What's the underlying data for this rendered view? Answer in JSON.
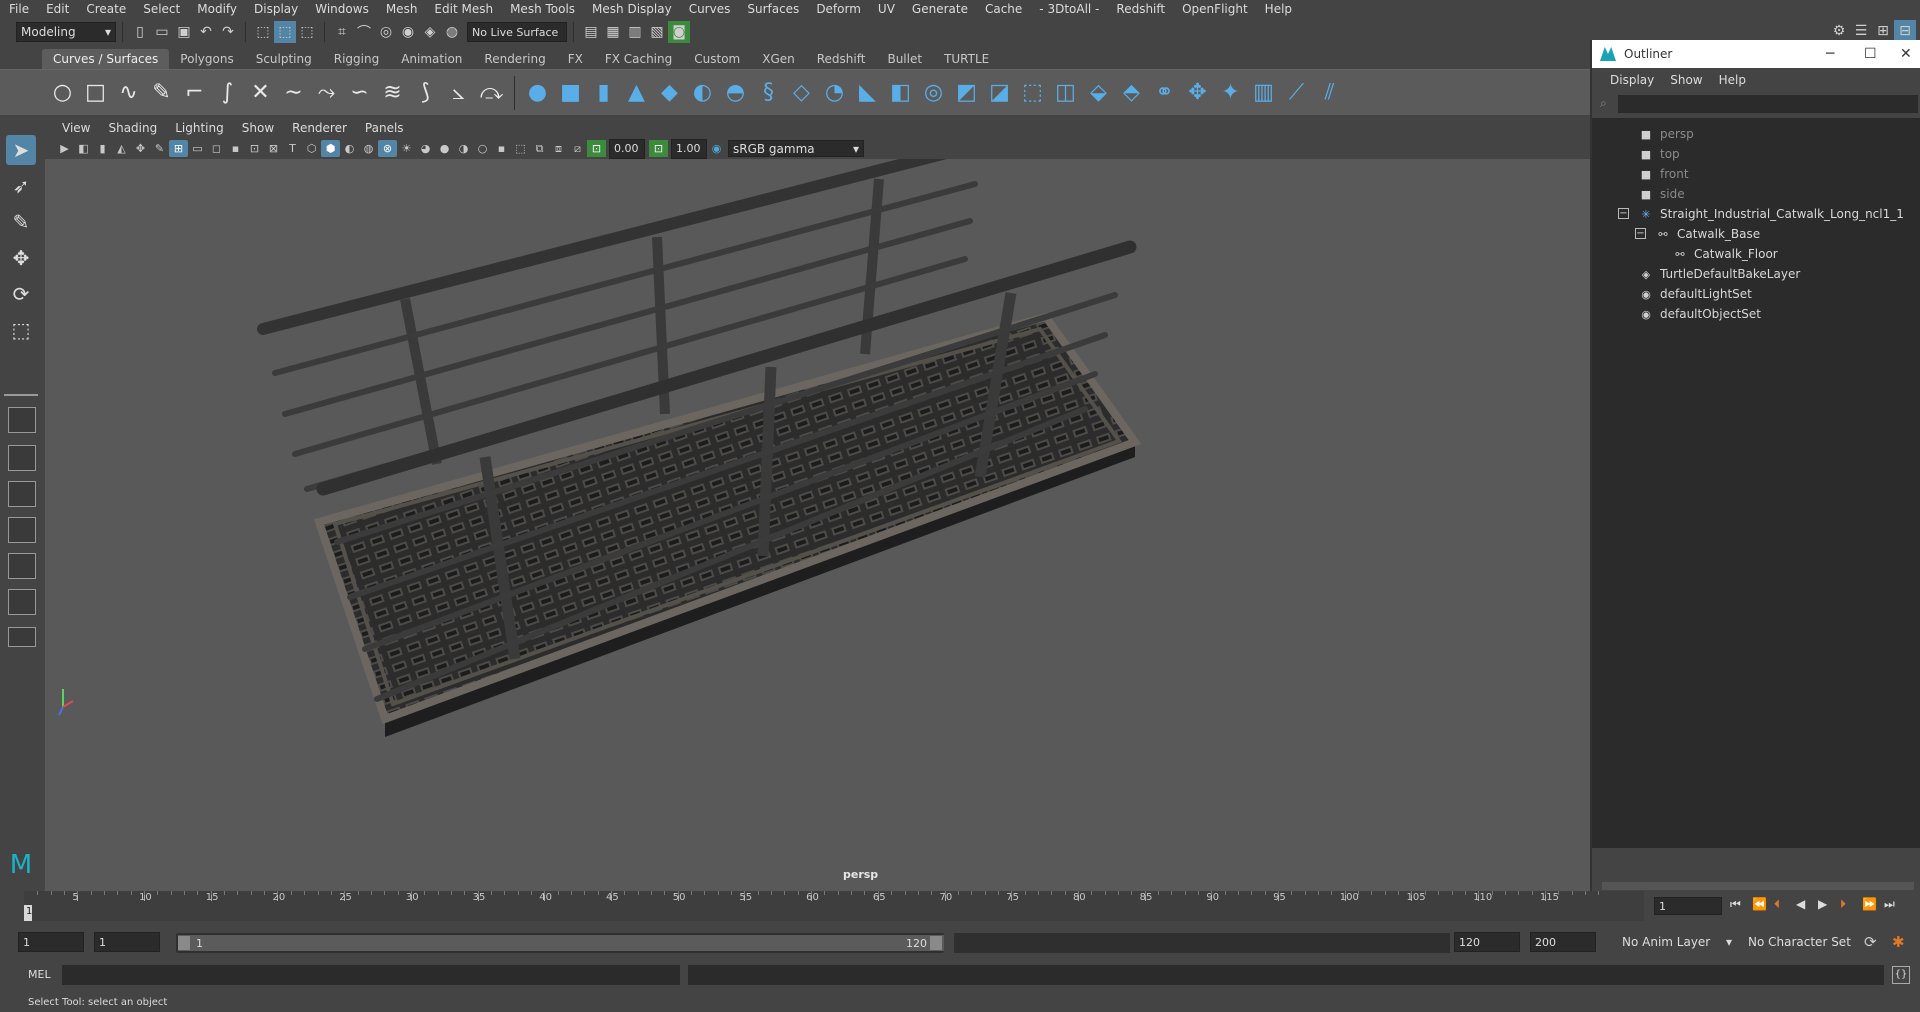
{
  "menubar": [
    "File",
    "Edit",
    "Create",
    "Select",
    "Modify",
    "Display",
    "Windows",
    "Mesh",
    "Edit Mesh",
    "Mesh Tools",
    "Mesh Display",
    "Curves",
    "Surfaces",
    "Deform",
    "UV",
    "Generate",
    "Cache",
    "- 3DtoAll -",
    "Redshift",
    "OpenFlight",
    "Help"
  ],
  "statusline": {
    "mode": "Modeling",
    "live_surface": "No Live Surface"
  },
  "shelf_tabs": [
    "Curves / Surfaces",
    "Polygons",
    "Sculpting",
    "Rigging",
    "Animation",
    "Rendering",
    "FX",
    "FX Caching",
    "Custom",
    "XGen",
    "Redshift",
    "Bullet",
    "TURTLE"
  ],
  "active_shelf_tab": "Curves / Surfaces",
  "panel_menu": [
    "View",
    "Shading",
    "Lighting",
    "Show",
    "Renderer",
    "Panels"
  ],
  "viewport_toolbar": {
    "exposure": "0.00",
    "gamma": "1.00",
    "color_space": "sRGB gamma"
  },
  "viewport": {
    "camera_label": "persp"
  },
  "outliner": {
    "title": "Outliner",
    "menu": [
      "Display",
      "Show",
      "Help"
    ],
    "nodes": [
      {
        "label": "persp",
        "type": "camera",
        "dim": true,
        "depth": 0
      },
      {
        "label": "top",
        "type": "camera",
        "dim": true,
        "depth": 0
      },
      {
        "label": "front",
        "type": "camera",
        "dim": true,
        "depth": 0
      },
      {
        "label": "side",
        "type": "camera",
        "dim": true,
        "depth": 0
      },
      {
        "label": "Straight_Industrial_Catwalk_Long_ncl1_1",
        "type": "group",
        "dim": false,
        "depth": 0
      },
      {
        "label": "Catwalk_Base",
        "type": "transform",
        "dim": false,
        "depth": 1
      },
      {
        "label": "Catwalk_Floor",
        "type": "transform",
        "dim": false,
        "depth": 2
      },
      {
        "label": "TurtleDefaultBakeLayer",
        "type": "bake",
        "dim": false,
        "depth": 0
      },
      {
        "label": "defaultLightSet",
        "type": "set",
        "dim": false,
        "depth": 0
      },
      {
        "label": "defaultObjectSet",
        "type": "set",
        "dim": false,
        "depth": 0
      }
    ]
  },
  "timeslider": {
    "ticks": [
      5,
      10,
      15,
      20,
      25,
      30,
      35,
      40,
      45,
      50,
      55,
      60,
      65,
      70,
      75,
      80,
      85,
      90,
      95,
      100,
      105,
      110,
      115
    ],
    "current_frame_label": "1",
    "current_frame_field": "1"
  },
  "range": {
    "start": "1",
    "playback_start": "1",
    "slider_start": "1",
    "slider_end": "120",
    "playback_end": "120",
    "end": "200",
    "anim_layer": "No Anim Layer",
    "character_set": "No Character Set"
  },
  "cmdline": {
    "label": "MEL"
  },
  "helpline": "Select Tool: select an object"
}
